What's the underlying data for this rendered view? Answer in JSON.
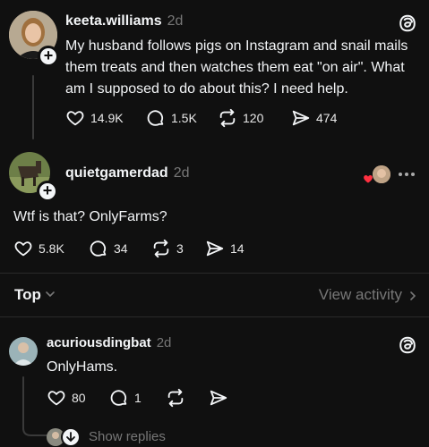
{
  "post1": {
    "username": "keeta.williams",
    "time": "2d",
    "text": "My husband follows pigs on Instagram and snail mails them treats and then watches them eat \"on air\". What am I supposed to do about this? I need help.",
    "likes": "14.9K",
    "comments": "1.5K",
    "reposts": "120",
    "shares": "474"
  },
  "post2": {
    "username": "quietgamerdad",
    "time": "2d",
    "text": "Wtf is that? OnlyFarms?",
    "likes": "5.8K",
    "comments": "34",
    "reposts": "3",
    "shares": "14"
  },
  "sort": {
    "label": "Top",
    "view_activity": "View activity"
  },
  "reply": {
    "username": "acuriousdingbat",
    "time": "2d",
    "text": "OnlyHams.",
    "likes": "80",
    "comments": "1",
    "show_replies": "Show replies"
  },
  "colors": {
    "background": "#101010",
    "text": "#f3f5f7",
    "muted": "#777777",
    "heart": "#ff3040"
  }
}
